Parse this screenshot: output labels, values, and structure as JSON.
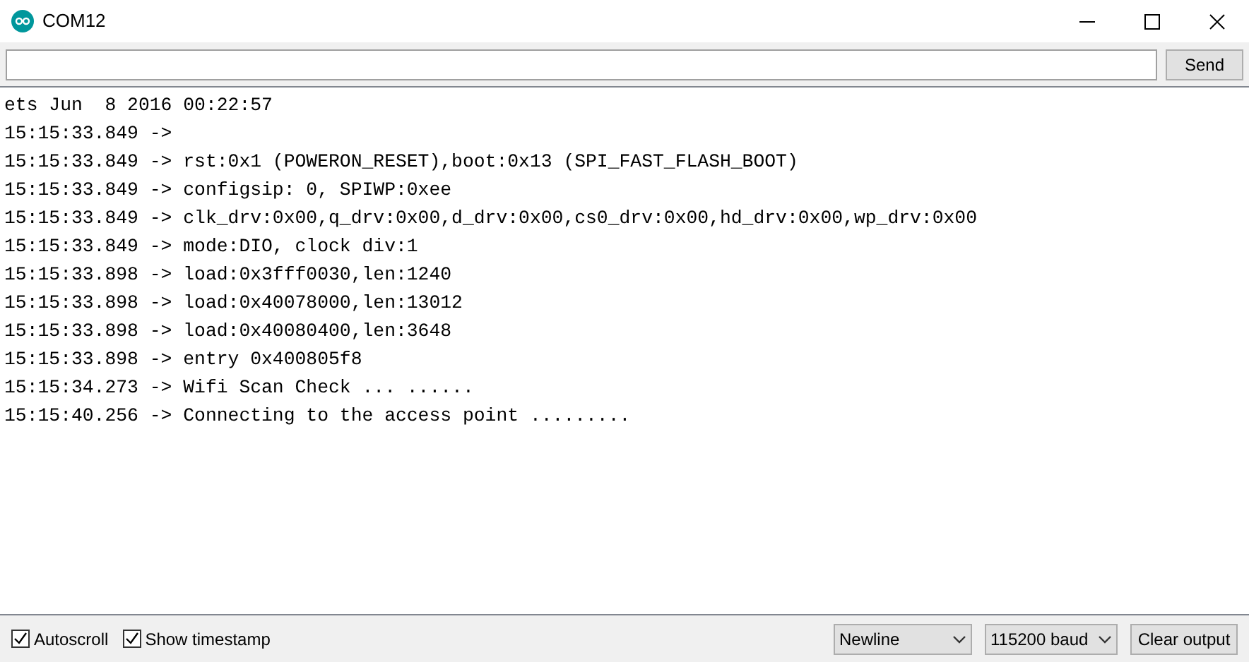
{
  "window": {
    "title": "COM12"
  },
  "send_button": "Send",
  "log": [
    "ets Jun  8 2016 00:22:57",
    "15:15:33.849 -> ",
    "15:15:33.849 -> rst:0x1 (POWERON_RESET),boot:0x13 (SPI_FAST_FLASH_BOOT)",
    "15:15:33.849 -> configsip: 0, SPIWP:0xee",
    "15:15:33.849 -> clk_drv:0x00,q_drv:0x00,d_drv:0x00,cs0_drv:0x00,hd_drv:0x00,wp_drv:0x00",
    "15:15:33.849 -> mode:DIO, clock div:1",
    "15:15:33.898 -> load:0x3fff0030,len:1240",
    "15:15:33.898 -> load:0x40078000,len:13012",
    "15:15:33.898 -> load:0x40080400,len:3648",
    "15:15:33.898 -> entry 0x400805f8",
    "15:15:34.273 -> Wifi Scan Check ... ......",
    "15:15:40.256 -> Connecting to the access point ........."
  ],
  "options": [
    {
      "label": "Autoscroll",
      "checked": true
    },
    {
      "label": "Show timestamp",
      "checked": true
    }
  ],
  "line_ending": "Newline",
  "baud": "115200 baud",
  "clear_button": "Clear output"
}
